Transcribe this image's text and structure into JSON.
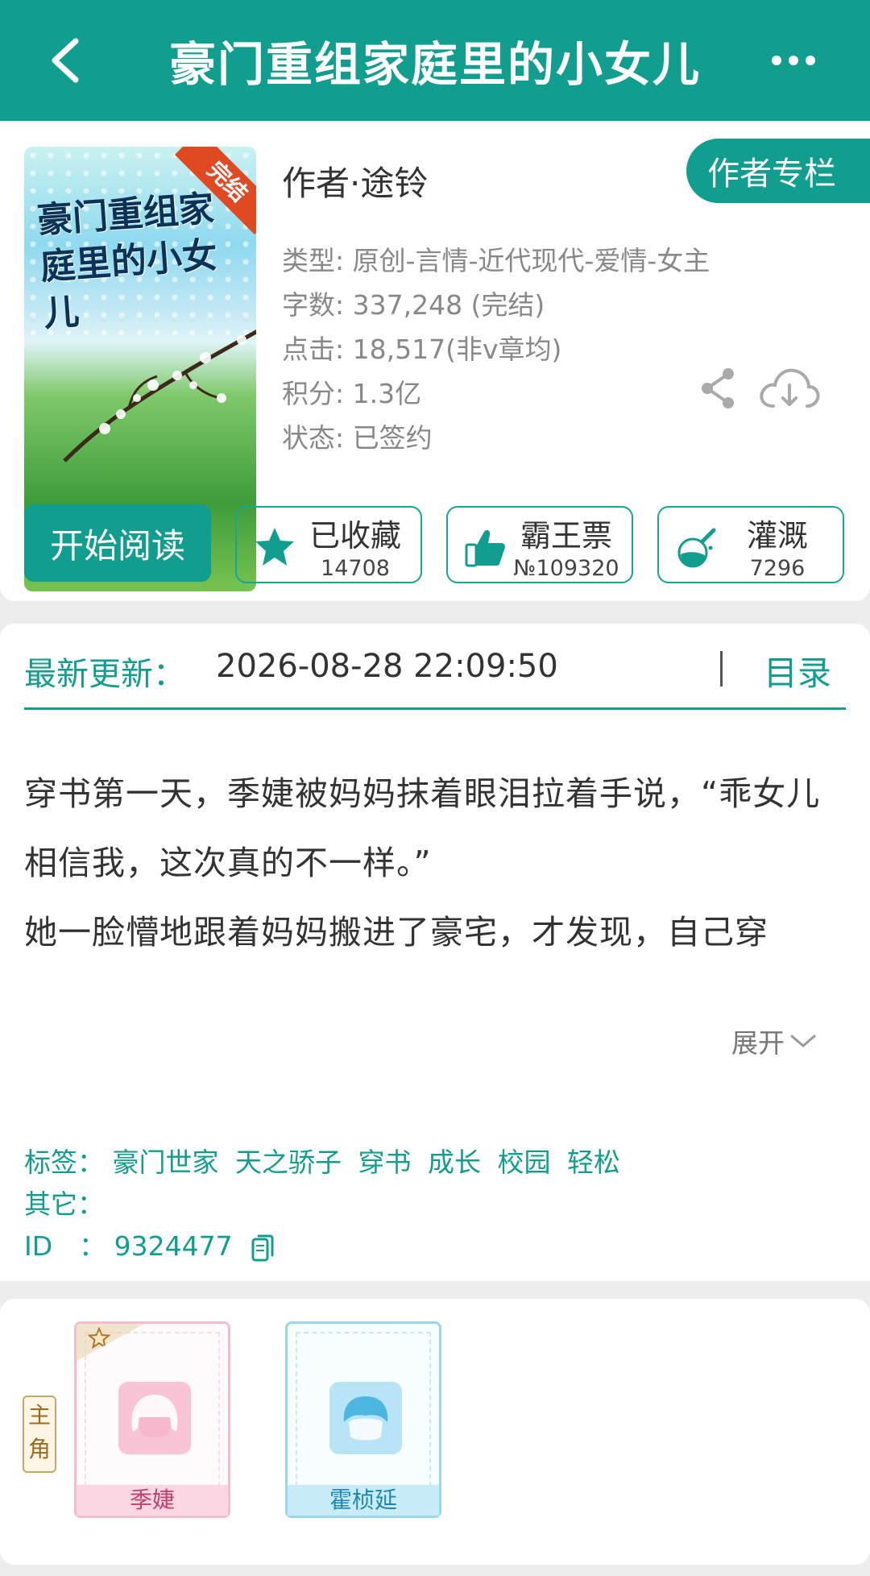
{
  "header": {
    "title": "豪门重组家庭里的小女儿"
  },
  "book": {
    "cover_title": "豪门重组家庭里的小女儿",
    "cover_badge": "完结",
    "author_line": "作者·途铃",
    "author_column_button": "作者专栏",
    "meta": {
      "type": "类型: 原创-言情-近代现代-爱情-女主",
      "words": "字数: 337,248 (完结)",
      "clicks": "点击: 18,517(非v章均)",
      "score": "积分: 1.3亿",
      "status": "状态: 已签约"
    }
  },
  "actions": {
    "read_label": "开始阅读",
    "favorite": {
      "label": "已收藏",
      "count": "14708"
    },
    "tickets": {
      "label": "霸王票",
      "count": "№109320"
    },
    "nutrient": {
      "label": "灌溉",
      "count": "7296"
    }
  },
  "update": {
    "label": "最新更新：",
    "time": "2026-08-28 22:09:50",
    "toc_link": "目录"
  },
  "description": {
    "paragraph1": "穿书第一天，季婕被妈妈抹着眼泪拉着手说，“乖女儿相信我，这次真的不一样。”",
    "paragraph2": "她一脸懵地跟着妈妈搬进了豪宅，才发现，自己穿",
    "expand_label": "展开"
  },
  "tags": {
    "label": "标签：",
    "items": [
      "豪门世家",
      "天之骄子",
      "穿书",
      "成长",
      "校园",
      "轻松"
    ],
    "other_label": "其它：",
    "id_label": "ID　：",
    "id_value": "9324477"
  },
  "characters": {
    "role_badge": "主角",
    "items": [
      {
        "name": "季婕"
      },
      {
        "name": "霍桢延"
      }
    ]
  },
  "colors": {
    "primary": "#119e8f",
    "female_accent": "#f3bdd0",
    "male_accent": "#9ad7ea"
  }
}
